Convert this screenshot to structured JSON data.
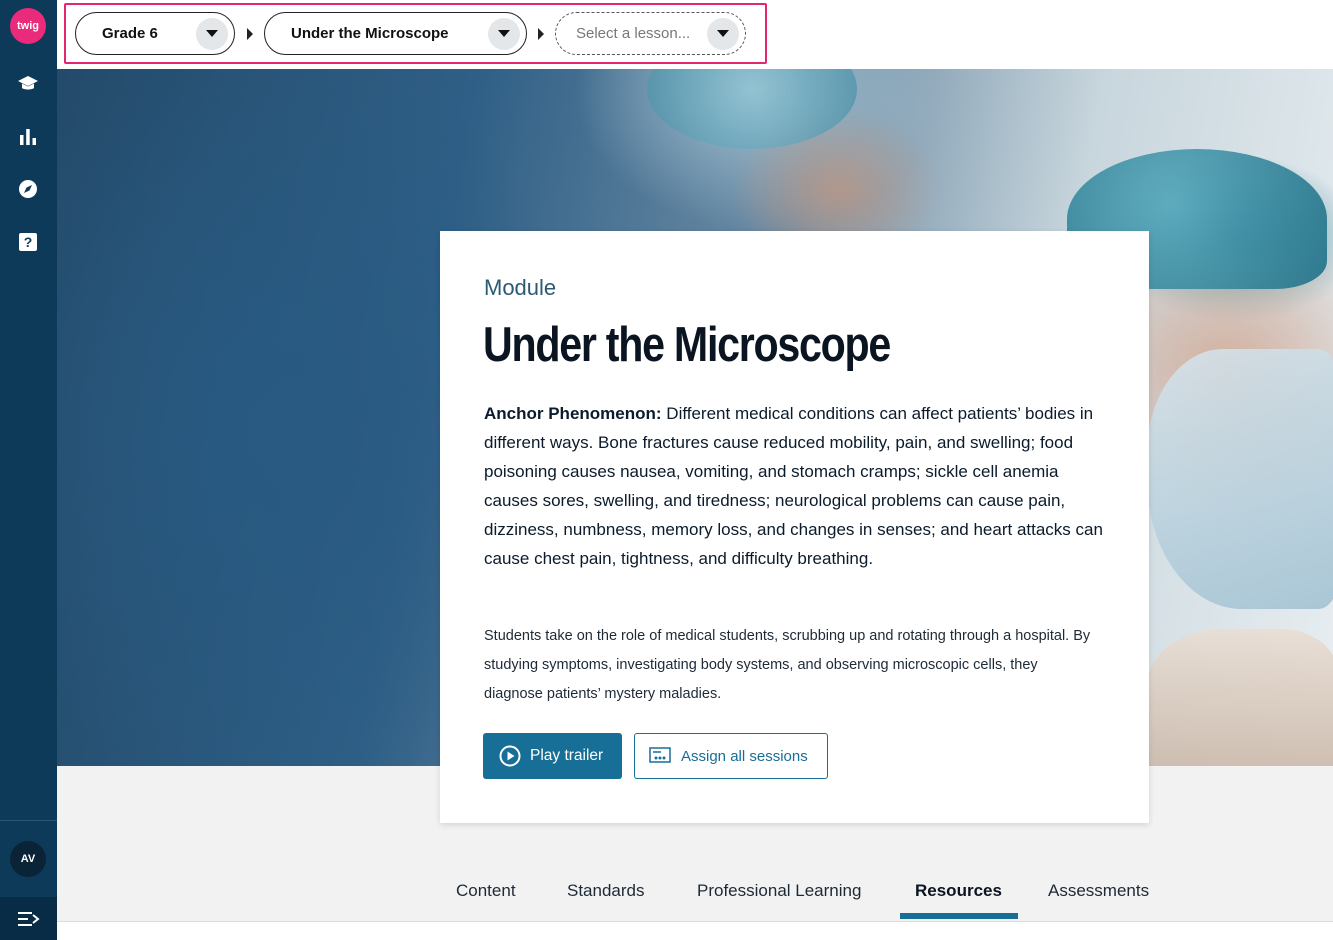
{
  "sidebar": {
    "logo_text": "twig",
    "avatar_initials": "AV",
    "icons": [
      "graduation-cap-icon",
      "bar-chart-icon",
      "compass-icon",
      "help-icon"
    ],
    "colors": {
      "background": "#0e3a5a",
      "logo": "#ea2a7a"
    }
  },
  "breadcrumb": {
    "grade": "Grade 6",
    "module": "Under the Microscope",
    "lesson_placeholder": "Select a lesson..."
  },
  "card": {
    "eyebrow": "Module",
    "title": "Under the Microscope",
    "phenomenon_label": "Anchor Phenomenon:",
    "phenomenon_text": " Different medical conditions can affect patients’ bodies in different ways. Bone fractures cause reduced mobility, pain, and swelling; food poisoning causes nausea, vomiting, and stomach cramps; sickle cell anemia causes sores, swelling, and tiredness; neurological problems can cause pain, dizziness, numbness, memory loss, and changes in senses; and heart attacks can cause chest pain, tightness, and difficulty breathing.",
    "description": "Students take on the role of medical students, scrubbing up and rotating through a hospital. By studying symptoms, investigating body systems, and observing microscopic cells, they diagnose patients’ mystery maladies.",
    "play_trailer": "Play trailer",
    "assign_all": "Assign all sessions"
  },
  "tabs": {
    "items": [
      {
        "label": "Content"
      },
      {
        "label": "Standards"
      },
      {
        "label": "Professional Learning"
      },
      {
        "label": "Resources",
        "active": true
      },
      {
        "label": "Assessments"
      }
    ]
  },
  "colors": {
    "accent": "#176e96",
    "highlight_border": "#e4266f"
  }
}
